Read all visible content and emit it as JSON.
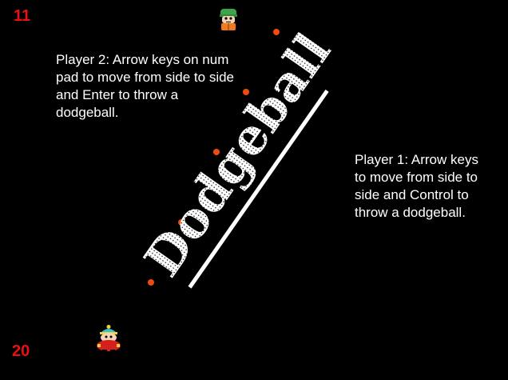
{
  "scores": {
    "player2": "11",
    "player1": "20"
  },
  "instructions": {
    "player2": "Player 2: Arrow keys on num\npad to move from side to side\nand Enter to throw a\ndodgeball.",
    "player1": "Player 1: Arrow keys\nto move from side to\nside and Control to\nthrow a dodgeball."
  },
  "title": "Dodgeball",
  "players": {
    "top": {
      "sprite": "kyle-sprite"
    },
    "bottom": {
      "sprite": "cartman-sprite"
    }
  },
  "balls": 5,
  "colors": {
    "background": "#000000",
    "score": "#e81010",
    "text": "#ffffff",
    "ball": "#f04a10"
  }
}
